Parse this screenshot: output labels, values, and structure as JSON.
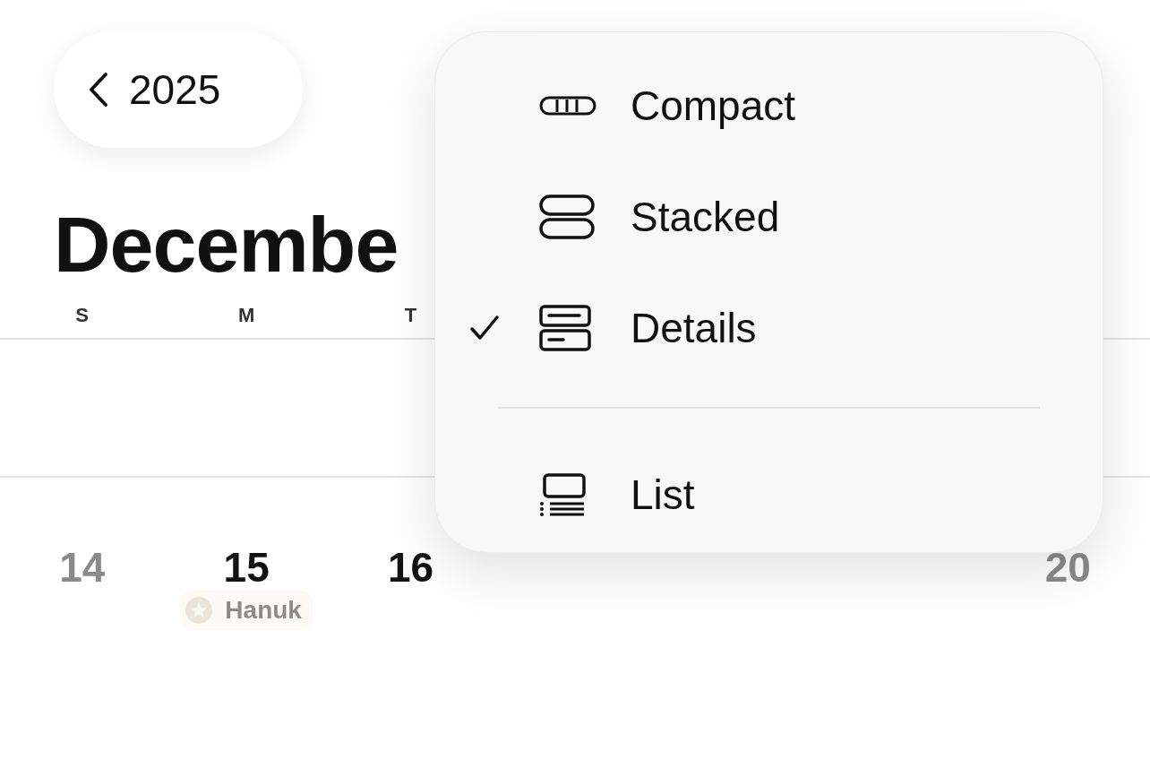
{
  "back_button": {
    "label": "2025"
  },
  "month_title": "Decembe",
  "weekdays": {
    "sun": "S",
    "mon": "M",
    "tue": "T"
  },
  "dates": {
    "sun": "14",
    "mon": "15",
    "tue": "16",
    "sat": "20"
  },
  "events": {
    "mon": "Hanuk"
  },
  "view_menu": {
    "items": [
      {
        "label": "Compact",
        "kind": "compact",
        "selected": false
      },
      {
        "label": "Stacked",
        "kind": "stacked",
        "selected": false
      },
      {
        "label": "Details",
        "kind": "details",
        "selected": true
      },
      {
        "label": "List",
        "kind": "list",
        "selected": false
      }
    ]
  }
}
